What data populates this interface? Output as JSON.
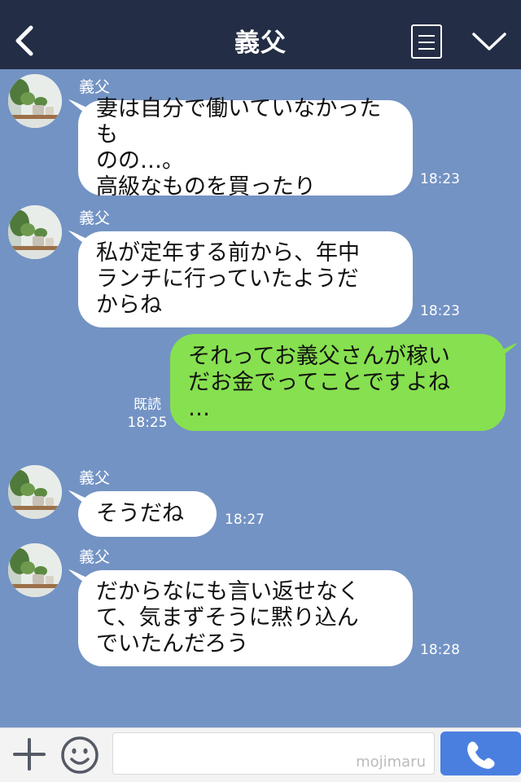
{
  "header": {
    "title": "義父"
  },
  "messages": [
    {
      "sender": "義父",
      "text": "妻は自分で働いていなかったも\nのの…。\n高級なものを買ったり",
      "time": "18:23"
    },
    {
      "sender": "義父",
      "text": "私が定年する前から、年中\nランチに行っていたようだ\nからね",
      "time": "18:23"
    },
    {
      "text": "それってお義父さんが稼い\nだお金でってことですよね\n…",
      "read_label": "既読",
      "time": "18:25"
    },
    {
      "sender": "義父",
      "text": "そうだね",
      "time": "18:27"
    },
    {
      "sender": "義父",
      "text": "だからなにも言い返せなく\nて、気まずそうに黙り込ん\nでいたんだろう",
      "time": "18:28"
    }
  ],
  "input": {
    "watermark": "mojimaru"
  },
  "colors": {
    "header_bg": "#232d45",
    "chat_bg": "#7393c4",
    "incoming_bubble": "#ffffff",
    "outgoing_bubble": "#86e04f",
    "call_button": "#4a7fe0"
  },
  "icons": [
    "back-arrow-icon",
    "menu-list-icon",
    "chevron-down-icon",
    "plus-icon",
    "emoji-icon",
    "phone-icon"
  ]
}
